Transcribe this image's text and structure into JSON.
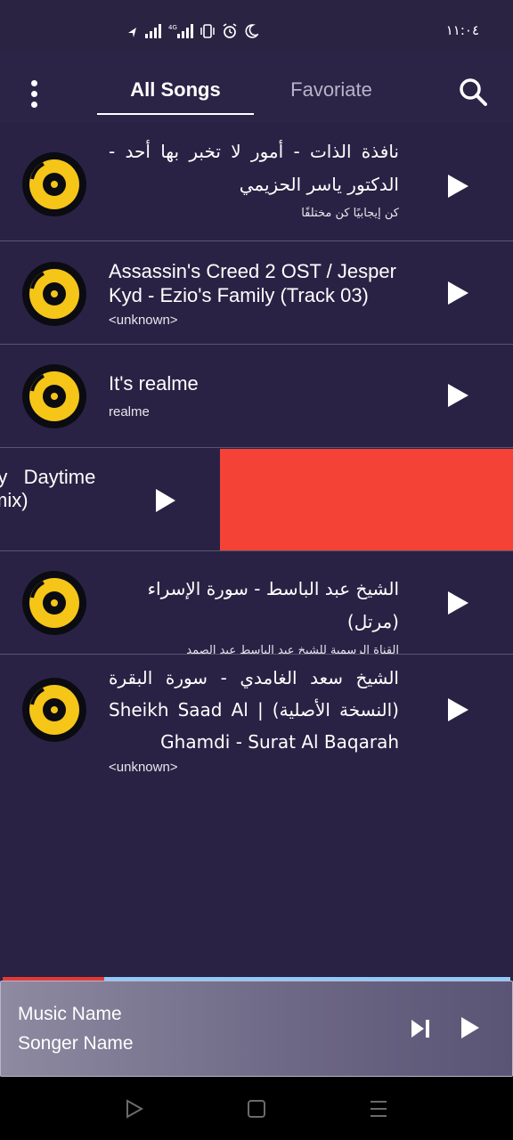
{
  "status_bar": {
    "time": "١١:٠٤",
    "icons": [
      "location-arrow-icon",
      "signal-icon",
      "4g-signal-icon",
      "vibrate-icon",
      "alarm-icon",
      "moon-icon"
    ]
  },
  "header": {
    "tabs": [
      {
        "label": "All Songs",
        "active": true
      },
      {
        "label": "Favoriate",
        "active": false
      }
    ],
    "menu_icon": "kebab-menu-icon",
    "search_icon": "search-icon"
  },
  "songs": [
    {
      "title": "نافذة الذات - أمور لا تخبر بها أحد - الدكتور ياسر الحزيمي",
      "artist": "كن إيجابيًا كن مختلفًا"
    },
    {
      "title": "Assassin's Creed 2 OST / Jesper Kyd - Ezio's Family (Track 03)",
      "artist": "<unknown>"
    },
    {
      "title": "It's realme",
      "artist": "realme"
    },
    {
      "title": "الشيخ عبد الباسط - سورة الإسراء (مرتل)",
      "artist": "القناة الرسمية للشيخ عبد الباسط عبد الصمد"
    },
    {
      "title": "الشيخ سعد الغامدي - سورة البقرة (النسخة الأصلية) | Sheikh Saad Al Ghamdi - Surat Al Baqarah",
      "artist": "<unknown>"
    }
  ],
  "swiped_item": {
    "title_line1": "ry   Daytime",
    "title_line2": "mix)"
  },
  "mini_player": {
    "music_name": "Music Name",
    "songer_name": "Songer Name",
    "progress": 0.2
  },
  "colors": {
    "background": "#2a2244",
    "accent_disc": "#f5c518",
    "delete": "#f44336",
    "progress_played": "#e53935",
    "progress_remaining": "#90caf9"
  },
  "nav_bar": {
    "icons": [
      "back-triangle-icon",
      "home-square-icon",
      "recents-menu-icon"
    ]
  }
}
